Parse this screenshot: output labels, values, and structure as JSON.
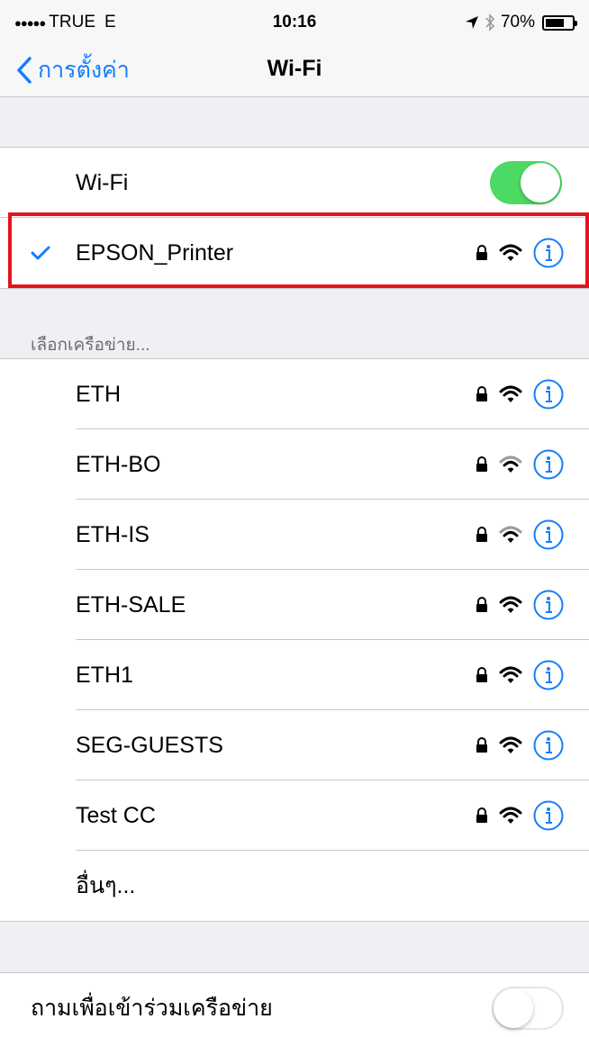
{
  "status_bar": {
    "carrier": "TRUE",
    "network": "E",
    "time": "10:16",
    "battery": "70%",
    "battery_level": 0.7,
    "icons": [
      "signal-dots-icon",
      "location-arrow-icon",
      "bluetooth-icon",
      "battery-icon"
    ]
  },
  "nav": {
    "back_label": "การตั้งค่า",
    "title": "Wi-Fi"
  },
  "wifi_toggle": {
    "label": "Wi-Fi",
    "on": true
  },
  "connected_network": {
    "name": "EPSON_Printer",
    "secured": true
  },
  "section_header": "เลือกเครือข่าย...",
  "networks": [
    {
      "name": "ETH",
      "secured": true,
      "signal": "strong"
    },
    {
      "name": "ETH-BO",
      "secured": true,
      "signal": "weak"
    },
    {
      "name": "ETH-IS",
      "secured": true,
      "signal": "weak"
    },
    {
      "name": "ETH-SALE",
      "secured": true,
      "signal": "strong"
    },
    {
      "name": "ETH1",
      "secured": true,
      "signal": "strong"
    },
    {
      "name": "SEG-GUESTS",
      "secured": true,
      "signal": "strong"
    },
    {
      "name": "Test CC",
      "secured": true,
      "signal": "strong"
    }
  ],
  "other_label": "อื่นๆ...",
  "ask_to_join": {
    "label": "ถามเพื่อเข้าร่วมเครือข่าย",
    "on": false
  },
  "colors": {
    "accent": "#147efb",
    "toggle_on": "#4cd964",
    "highlight": "#e5141b",
    "background": "#efeff4"
  }
}
